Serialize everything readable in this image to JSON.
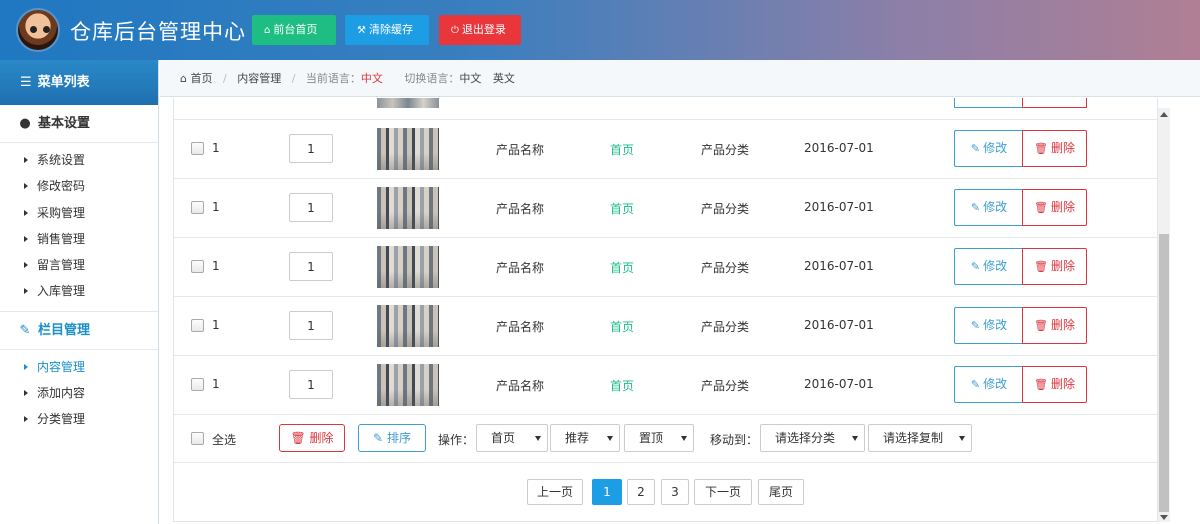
{
  "header": {
    "title": "仓库后台管理中心",
    "buttons": {
      "home": "前台首页",
      "clear_cache": "清除缓存",
      "logout": "退出登录"
    }
  },
  "sidebar": {
    "title": "菜单列表",
    "groups": [
      {
        "label": "基本设置",
        "items": [
          "系统设置",
          "修改密码",
          "采购管理",
          "销售管理",
          "留言管理",
          "入库管理"
        ]
      },
      {
        "label": "栏目管理",
        "items": [
          "内容管理",
          "添加内容",
          "分类管理"
        ]
      }
    ]
  },
  "breadcrumb": {
    "home": "首页",
    "current_page": "内容管理",
    "lang_label": "当前语言：",
    "lang_value": "中文",
    "switch_label": "切换语言：",
    "switch_zh": "中文",
    "switch_en": "英文"
  },
  "table": {
    "rows": [
      {
        "id": "1",
        "order": "1",
        "name": "产品名称",
        "position": "首页",
        "category": "产品分类",
        "date": "2016-07-01"
      },
      {
        "id": "1",
        "order": "1",
        "name": "产品名称",
        "position": "首页",
        "category": "产品分类",
        "date": "2016-07-01"
      },
      {
        "id": "1",
        "order": "1",
        "name": "产品名称",
        "position": "首页",
        "category": "产品分类",
        "date": "2016-07-01"
      },
      {
        "id": "1",
        "order": "1",
        "name": "产品名称",
        "position": "首页",
        "category": "产品分类",
        "date": "2016-07-01"
      },
      {
        "id": "1",
        "order": "1",
        "name": "产品名称",
        "position": "首页",
        "category": "产品分类",
        "date": "2016-07-01"
      }
    ],
    "edit_label": "修改",
    "delete_label": "删除"
  },
  "footer": {
    "select_all": "全选",
    "delete": "删除",
    "sort": "排序",
    "operation_label": "操作：",
    "op_selects": [
      "首页",
      "推荐",
      "置顶"
    ],
    "move_label": "移动到：",
    "move_select": "请选择分类",
    "copy_select": "请选择复制"
  },
  "pagination": {
    "prev": "上一页",
    "pages": [
      "1",
      "2",
      "3"
    ],
    "current": "1",
    "next": "下一页",
    "last": "尾页"
  },
  "colors": {
    "primary": "#1d9ee4",
    "success": "#1ebd83",
    "danger": "#e8363b"
  }
}
